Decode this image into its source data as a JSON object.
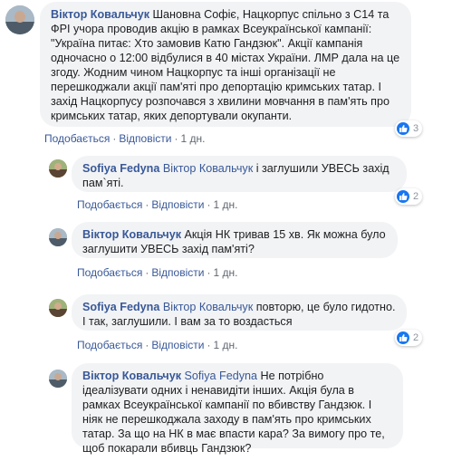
{
  "labels": {
    "like": "Подобається",
    "reply": "Відповісти",
    "dot": "·"
  },
  "colors": {
    "link": "#385898",
    "bubble": "#f2f3f5",
    "like": "#1877f2",
    "meta": "#606770"
  },
  "comments": [
    {
      "author": "Віктор Ковальчук",
      "mention": "",
      "text": "Шановна Софіє, Нацкорпус спільно з С14 та ФРІ учора проводив акцію в рамках Всеукраїнської кампанії: \"Україна питає: Хто замовив Катю Гандзюк\". Акції кампанія одночасно о 12:00 відбулися в 40 містах України. ЛМР дала на це згоду. Жодним чином Нацкорпус та інші організації не перешкоджали акції пам'яті про депортацію кримських татар. І захід Нацкорпусу розпочався з хвилини мовчання в пам'ять про кримських татар, яких депортували окупанти.",
      "time": "1 дн.",
      "reactions": "3"
    },
    {
      "author": "Sofiya Fedyna",
      "mention": "Віктор Ковальчук",
      "text": " і заглушили УВЕСЬ захід пам`яті.",
      "time": "1 дн.",
      "reactions": "2"
    },
    {
      "author": "Віктор Ковальчук",
      "mention": "",
      "text": "Акція НК тривав 15 хв. Як можна було заглушити УВЕСЬ захід пам'яті?",
      "time": "1 дн.",
      "reactions": ""
    },
    {
      "author": "Sofiya Fedyna",
      "mention": "Віктор Ковальчук",
      "text": " повторю, це було гидотно. І так, заглушили. І вам за то воздасться",
      "time": "1 дн.",
      "reactions": "2"
    },
    {
      "author": "Віктор Ковальчук",
      "mention": "Sofiya Fedyna",
      "text": " Не потрібно ідеалізувати одних і ненавидіти інших. Акція була в рамках Всеукраїнської кампанії по вбивству Гандзюк. І ніяк не перешкоджала заходу в пам'ять про кримських татар. За що на НК в має впасти кара? За вимогу про те, щоб покарали вбивць Гандзюк?",
      "time": "",
      "reactions": ""
    }
  ]
}
